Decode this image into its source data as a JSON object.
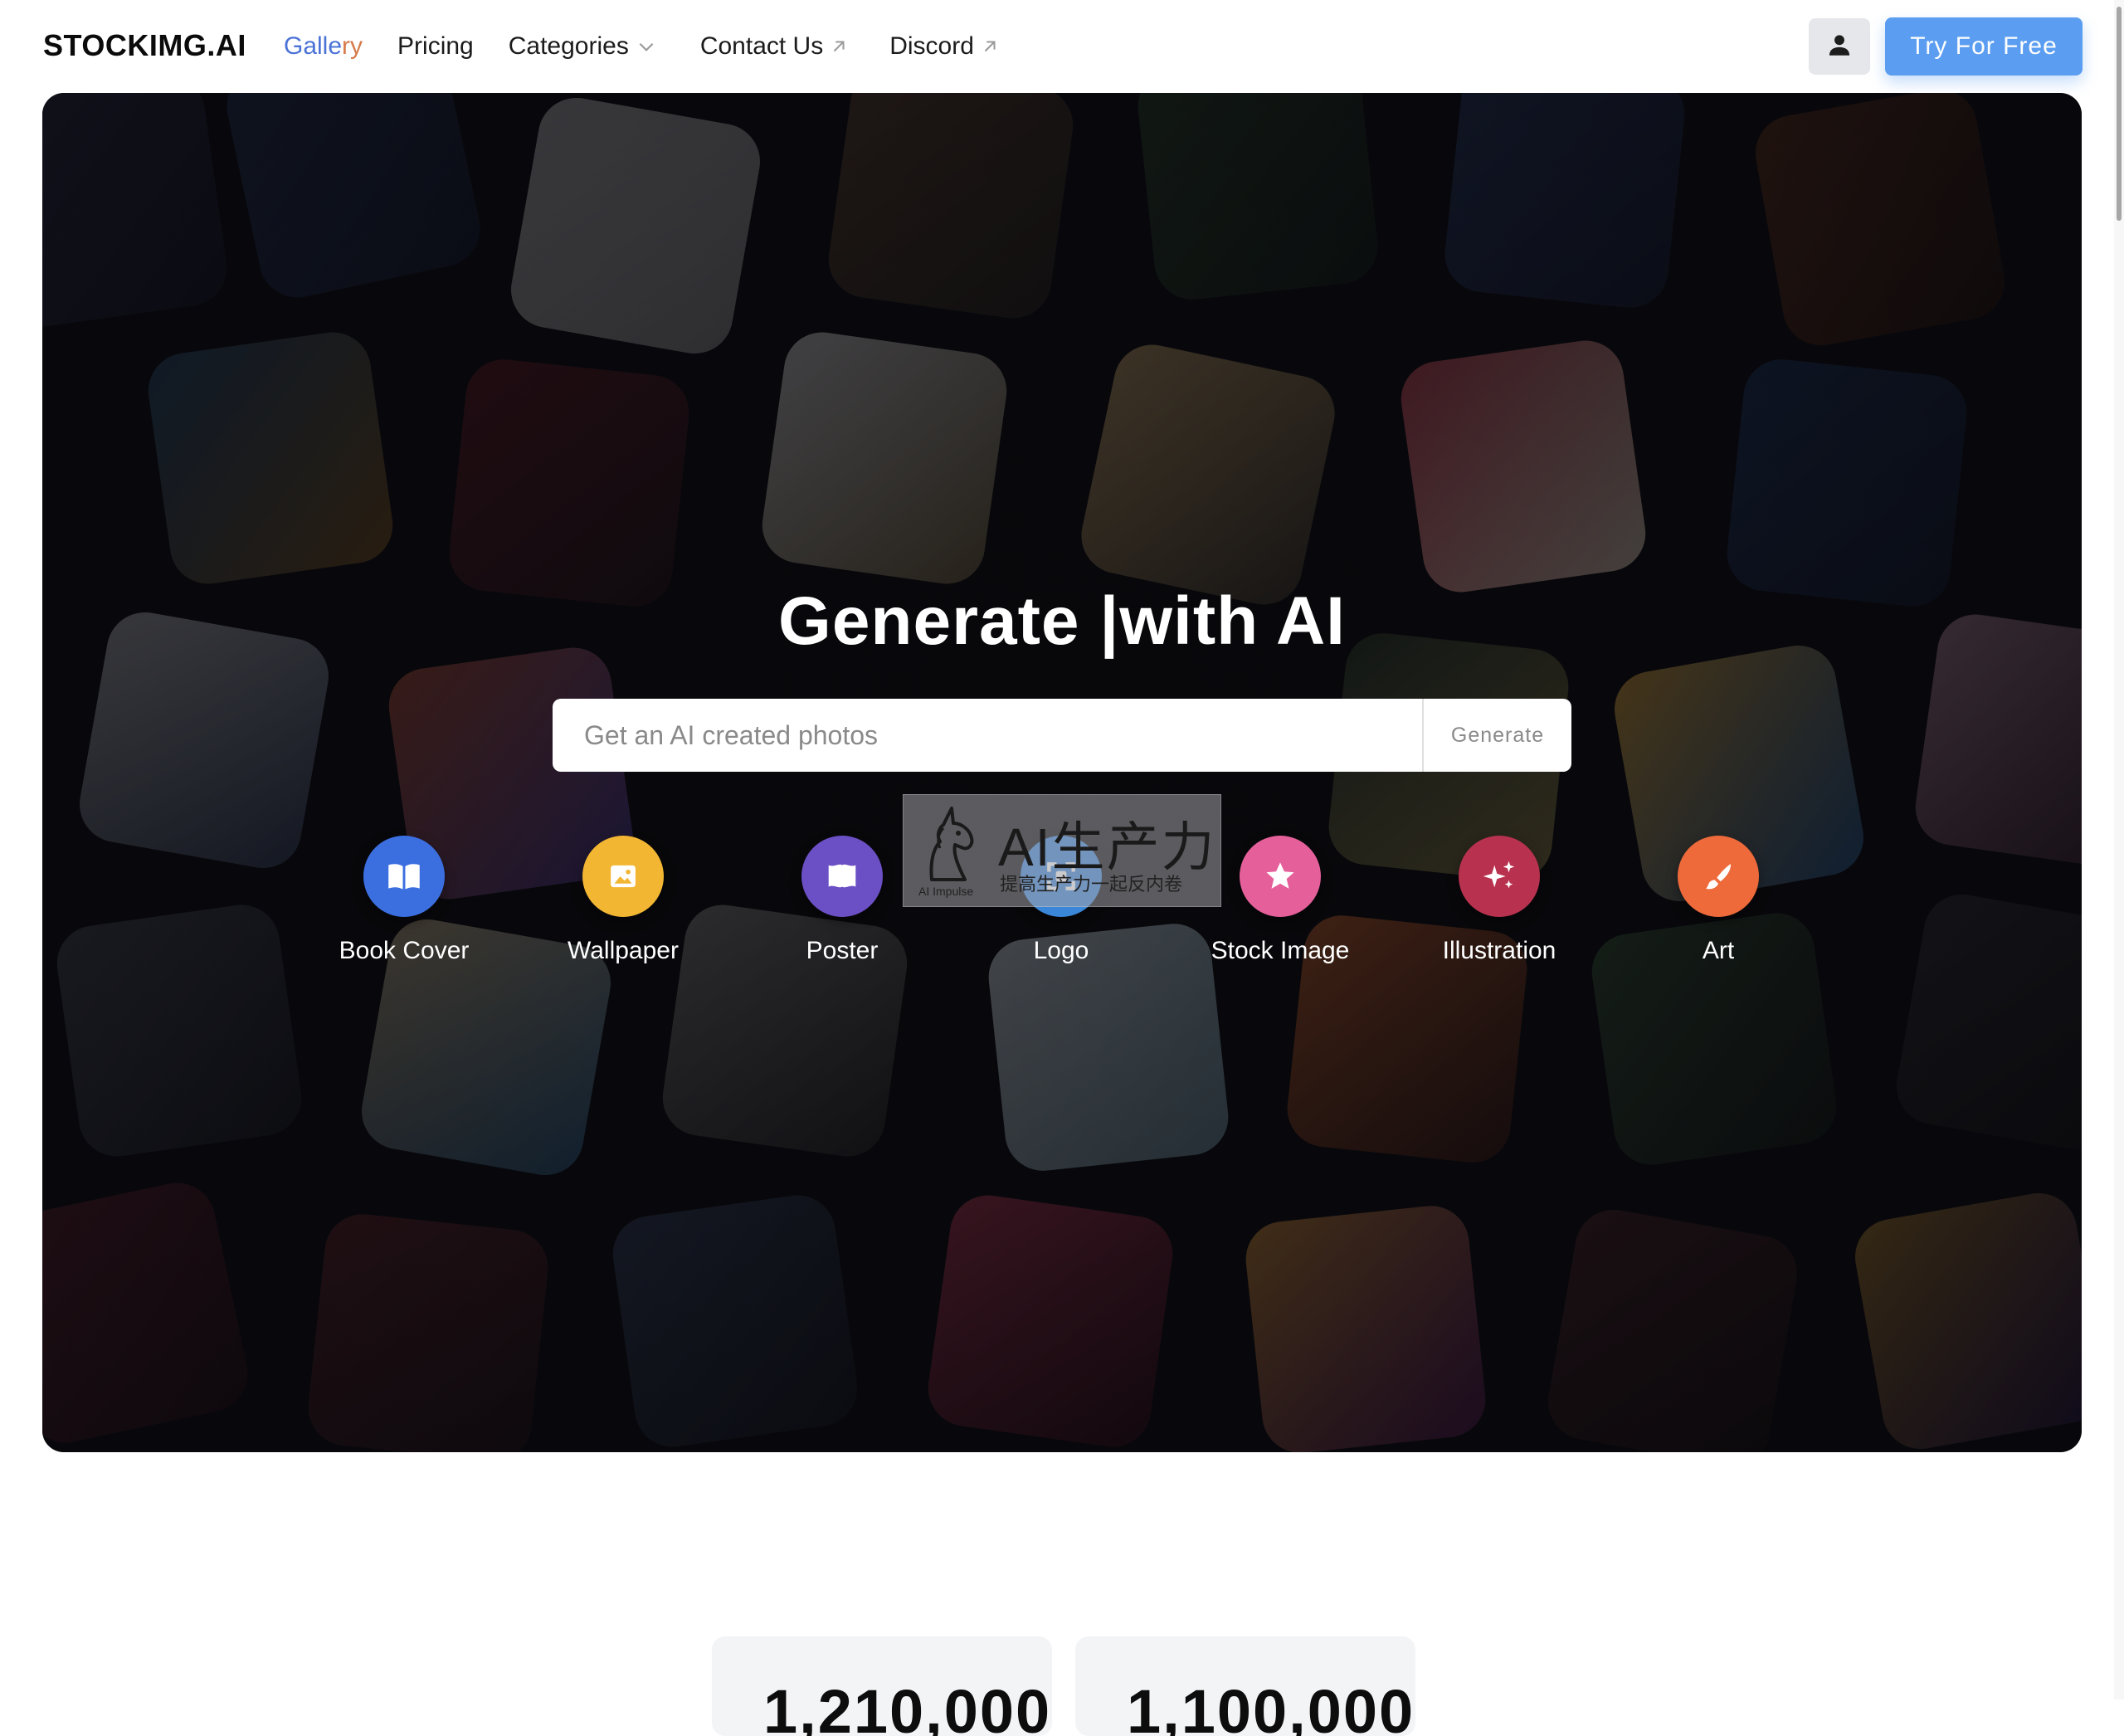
{
  "nav": {
    "logo": "STOCKIMG.AI",
    "gallery": "Gallery",
    "gallery_part1": "Galle",
    "gallery_part2": "ry",
    "pricing": "Pricing",
    "categories": "Categories",
    "contact": "Contact Us",
    "discord": "Discord",
    "try_free": "Try For Free",
    "accent_color": "#4b73d6",
    "cta_color": "#5b9df0"
  },
  "hero": {
    "title": "Generate |with AI",
    "search_placeholder": "Get an AI created photos",
    "generate_label": "Generate",
    "categories": [
      {
        "label": "Book Cover",
        "icon": "book-open-icon",
        "color": "#3b6fe0"
      },
      {
        "label": "Wallpaper",
        "icon": "image-icon",
        "color": "#f2b632"
      },
      {
        "label": "Poster",
        "icon": "flag-icon",
        "color": "#6b4fc4"
      },
      {
        "label": "Logo",
        "icon": "scan-icon",
        "color": "#3a86d9"
      },
      {
        "label": "Stock Image",
        "icon": "star-icon",
        "color": "#e5609a"
      },
      {
        "label": "Illustration",
        "icon": "sparkles-icon",
        "color": "#b8324f"
      },
      {
        "label": "Art",
        "icon": "brush-icon",
        "color": "#ee6a3a"
      }
    ]
  },
  "watermark": {
    "main": "AI生产力",
    "sub": "提高生产力一起反内卷",
    "tiny": "AI Impulse"
  },
  "stats": [
    {
      "value": "1,210,000"
    },
    {
      "value": "1,100,000"
    }
  ]
}
